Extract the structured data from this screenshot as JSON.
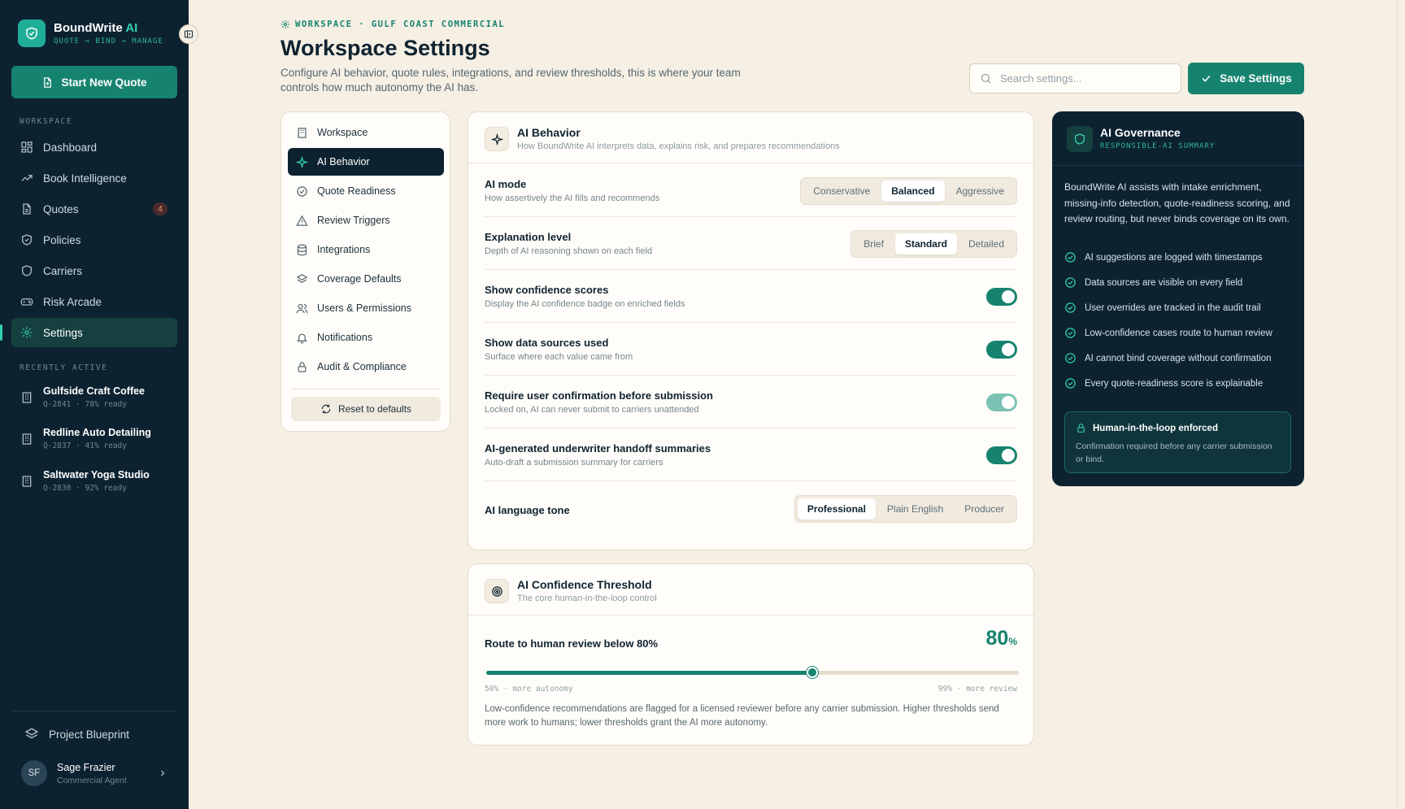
{
  "app": {
    "name": "BoundWrite",
    "name_ai": "AI",
    "tagline": "QUOTE → BIND → MANAGE",
    "start_quote": "Start New Quote"
  },
  "sidebar": {
    "workspace_label": "WORKSPACE",
    "nav": [
      {
        "label": "Dashboard",
        "icon": "dashboard-icon"
      },
      {
        "label": "Book Intelligence",
        "icon": "trend-icon"
      },
      {
        "label": "Quotes",
        "icon": "document-icon",
        "badge": "4"
      },
      {
        "label": "Policies",
        "icon": "shield-icon"
      },
      {
        "label": "Carriers",
        "icon": "shield-icon"
      },
      {
        "label": "Risk Arcade",
        "icon": "gamepad-icon"
      },
      {
        "label": "Settings",
        "icon": "gear-icon",
        "active": true
      }
    ],
    "recent_label": "RECENTLY ACTIVE",
    "recent": [
      {
        "title": "Gulfside Craft Coffee",
        "sub": "Q-2841 · 78% ready"
      },
      {
        "title": "Redline Auto Detailing",
        "sub": "Q-2837 · 41% ready"
      },
      {
        "title": "Saltwater Yoga Studio",
        "sub": "Q-2830 · 92% ready"
      }
    ],
    "blueprint": "Project Blueprint",
    "user": {
      "initials": "SF",
      "name": "Sage Frazier",
      "role": "Commercial Agent"
    }
  },
  "header": {
    "crumb": "WORKSPACE · GULF COAST COMMERCIAL",
    "title": "Workspace Settings",
    "description": "Configure AI behavior, quote rules, integrations, and review thresholds, this is where your team controls how much autonomy the AI has.",
    "search_placeholder": "Search settings...",
    "save": "Save Settings"
  },
  "settings_nav": {
    "items": [
      {
        "label": "Workspace",
        "icon": "building-icon"
      },
      {
        "label": "AI Behavior",
        "icon": "sparkle-icon",
        "active": true
      },
      {
        "label": "Quote Readiness",
        "icon": "check-circle-icon"
      },
      {
        "label": "Review Triggers",
        "icon": "warning-icon"
      },
      {
        "label": "Integrations",
        "icon": "database-icon"
      },
      {
        "label": "Coverage Defaults",
        "icon": "layers-icon"
      },
      {
        "label": "Users & Permissions",
        "icon": "users-icon"
      },
      {
        "label": "Notifications",
        "icon": "bell-icon"
      },
      {
        "label": "Audit & Compliance",
        "icon": "lock-icon"
      }
    ],
    "reset": "Reset to defaults"
  },
  "behavior": {
    "title": "AI Behavior",
    "subtitle": "How BoundWrite AI interprets data, explains risk, and prepares recommendations",
    "mode": {
      "title": "AI mode",
      "sub": "How assertively the AI fills and recommends",
      "options": [
        "Conservative",
        "Balanced",
        "Aggressive"
      ],
      "selected": "Balanced"
    },
    "explanation": {
      "title": "Explanation level",
      "sub": "Depth of AI reasoning shown on each field",
      "options": [
        "Brief",
        "Standard",
        "Detailed"
      ],
      "selected": "Standard"
    },
    "toggles": [
      {
        "title": "Show confidence scores",
        "sub": "Display the AI confidence badge on enriched fields",
        "on": true,
        "locked": false
      },
      {
        "title": "Show data sources used",
        "sub": "Surface where each value came from",
        "on": true,
        "locked": false
      },
      {
        "title": "Require user confirmation before submission",
        "sub": "Locked on, AI can never submit to carriers unattended",
        "on": true,
        "locked": true
      },
      {
        "title": "AI-generated underwriter handoff summaries",
        "sub": "Auto-draft a submission summary for carriers",
        "on": true,
        "locked": false
      }
    ],
    "tone": {
      "title": "AI language tone",
      "options": [
        "Professional",
        "Plain English",
        "Producer"
      ],
      "selected": "Professional"
    }
  },
  "threshold": {
    "title": "AI Confidence Threshold",
    "subtitle": "The core human-in-the-loop control",
    "label": "Route to human review below 80%",
    "value": "80",
    "unit": "%",
    "min": 50,
    "max": 99,
    "current": 80,
    "low_label": "50% · more autonomy",
    "high_label": "99% · more review",
    "note": "Low-confidence recommendations are flagged for a licensed reviewer before any carrier submission. Higher thresholds send more work to humans; lower thresholds grant the AI more autonomy."
  },
  "governance": {
    "title": "AI Governance",
    "subtitle": "RESPONSIBLE-AI SUMMARY",
    "intro": "BoundWrite AI assists with intake enrichment, missing-info detection, quote-readiness scoring, and review routing, but never binds coverage on its own.",
    "checks": [
      "AI suggestions are logged with timestamps",
      "Data sources are visible on every field",
      "User overrides are tracked in the audit trail",
      "Low-confidence cases route to human review",
      "AI cannot bind coverage without confirmation",
      "Every quote-readiness score is explainable"
    ],
    "box_title": "Human-in-the-loop enforced",
    "box_text": "Confirmation required before any carrier submission or bind."
  },
  "colors": {
    "accent": "#16836f",
    "sidebar": "#0d2231",
    "background": "#f5efe4"
  }
}
